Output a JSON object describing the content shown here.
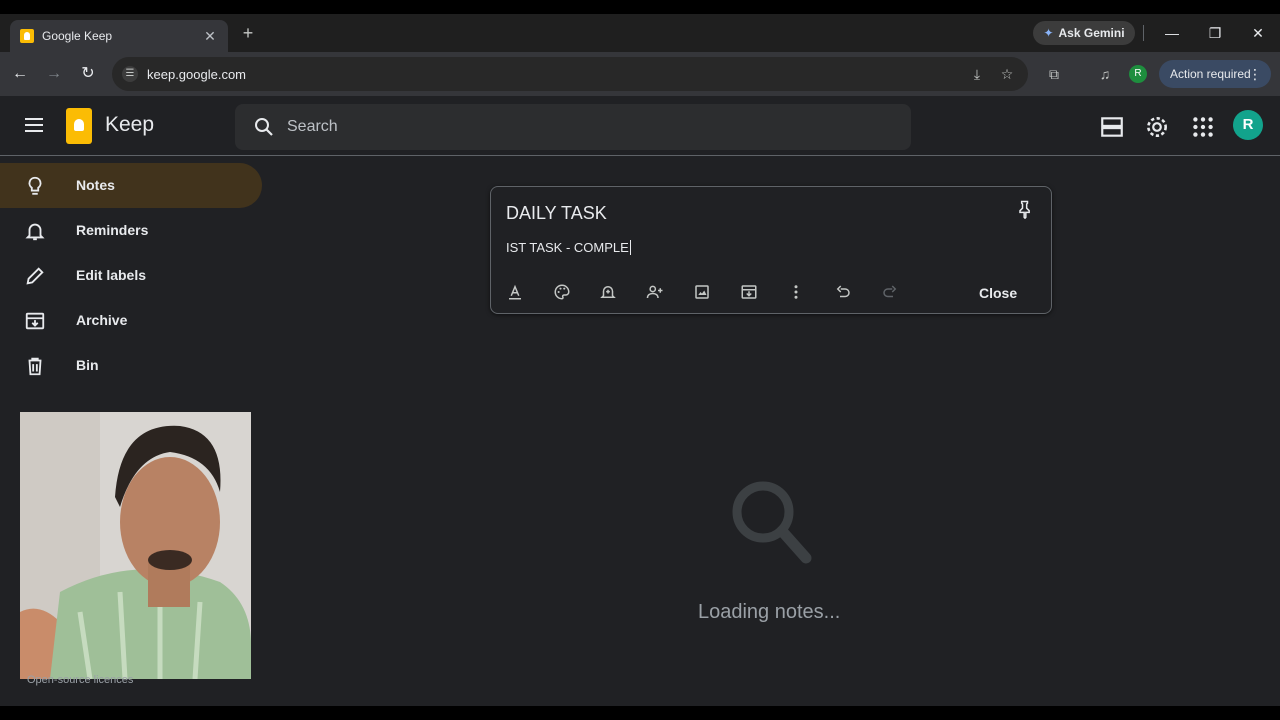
{
  "browser": {
    "tab_title": "Google Keep",
    "new_tab": "+",
    "close_tab": "✕",
    "gemini_label": "Ask Gemini",
    "url": "keep.google.com",
    "profile_initial": "R",
    "action_label": "Action required"
  },
  "keep": {
    "app_name": "Keep",
    "search_placeholder": "Search",
    "avatar_initial": "R"
  },
  "sidebar": {
    "items": [
      {
        "label": "Notes",
        "icon": "lightbulb-icon",
        "active": true
      },
      {
        "label": "Reminders",
        "icon": "bell-icon"
      },
      {
        "label": "Edit labels",
        "icon": "pencil-icon"
      },
      {
        "label": "Archive",
        "icon": "archive-icon"
      },
      {
        "label": "Bin",
        "icon": "trash-icon"
      }
    ],
    "footer": "Open-source licences"
  },
  "note": {
    "title": "DAILY TASK",
    "body": "IST TASK - COMPLE",
    "close_label": "Close"
  },
  "loading": {
    "text": "Loading notes..."
  },
  "colors": {
    "background": "#202124",
    "active_nav": "#41331c",
    "keep_yellow": "#fbbc04",
    "avatar": "#12a38c"
  }
}
